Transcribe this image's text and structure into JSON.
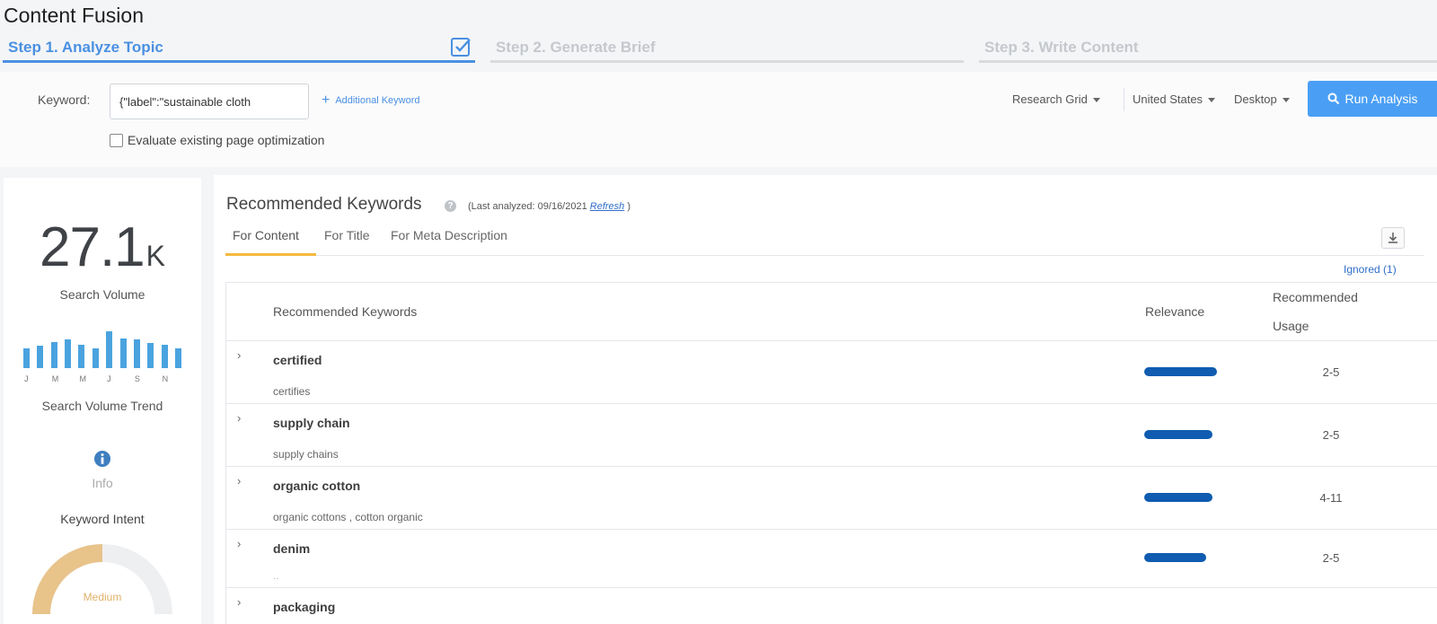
{
  "app_title": "Content Fusion",
  "steps": [
    {
      "label": "Step 1. Analyze Topic",
      "active": true
    },
    {
      "label": "Step 2. Generate Brief",
      "active": false
    },
    {
      "label": "Step 3. Write Content",
      "active": false
    }
  ],
  "analyze": {
    "keyword_label": "Keyword:",
    "keyword_value": "{\"label\":\"sustainable cloth",
    "additional_keyword": "Additional Keyword",
    "evaluate_label": "Evaluate existing page optimization",
    "evaluate_checked": false,
    "research_grid": "Research Grid",
    "country": "United States",
    "device": "Desktop",
    "run_button": "Run Analysis"
  },
  "summary": {
    "volume_number": "27.1",
    "volume_unit": "K",
    "volume_label": "Search Volume",
    "trend_label": "Search Volume Trend",
    "trend_months": [
      "J",
      "M",
      "M",
      "J",
      "S",
      "N"
    ],
    "trend_values": [
      0.5,
      0.56,
      0.66,
      0.73,
      0.6,
      0.5,
      0.93,
      0.76,
      0.73,
      0.63,
      0.6,
      0.5
    ],
    "info_label": "Info",
    "intent_label": "Keyword Intent",
    "intent_value": "Medium",
    "intent_level": 0.5,
    "intent_color": "#e8c38a"
  },
  "recommended": {
    "title": "Recommended Keywords",
    "last_analyzed_prefix": "(Last analyzed: 09/16/2021",
    "refresh": "Refresh",
    "last_analyzed_suffix": ")",
    "tabs": [
      "For Content",
      "For Title",
      "For Meta Description"
    ],
    "ignored": "Ignored (1)",
    "headers": {
      "keyword": "Recommended Keywords",
      "relevance": "Relevance",
      "usage_line1": "Recommended",
      "usage_line2": "Usage"
    },
    "rows": [
      {
        "keyword": "certified",
        "variants": "certifies",
        "relevance": 0.97,
        "usage": "2-5"
      },
      {
        "keyword": "supply chain",
        "variants": "supply chains",
        "relevance": 0.91,
        "usage": "2-5"
      },
      {
        "keyword": "organic cotton",
        "variants": "organic cottons ,   cotton organic",
        "relevance": 0.91,
        "usage": "4-11"
      },
      {
        "keyword": "denim",
        "variants": "..",
        "relevance": 0.82,
        "usage": "2-5"
      },
      {
        "keyword": "packaging",
        "variants": "",
        "relevance": 0,
        "usage": ""
      }
    ]
  },
  "colors": {
    "accent": "#4a90e2",
    "run_button": "#4a9ff5",
    "relevance_bar": "#0f5cb0",
    "tab_underline": "#f5b940",
    "trend_bar": "#4aa3df"
  }
}
